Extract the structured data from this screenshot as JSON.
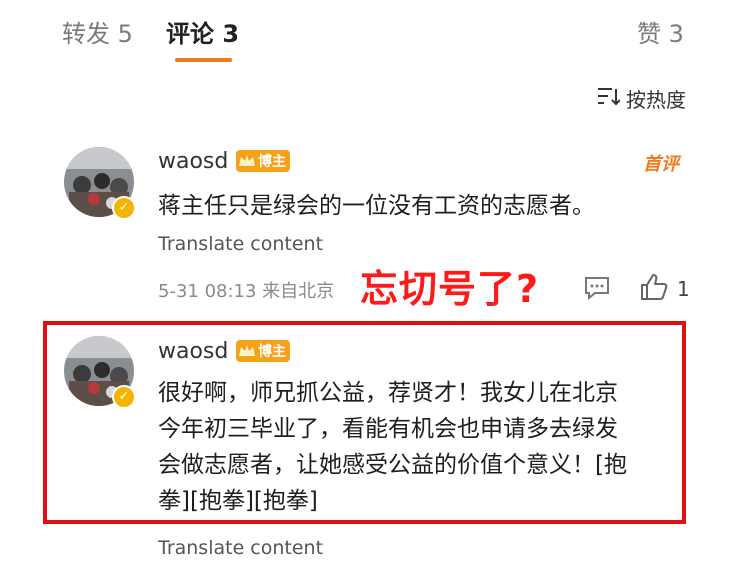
{
  "tabs": {
    "repost": "转发 5",
    "comments": "评论 3",
    "likes": "赞 3"
  },
  "sort": {
    "label": "按热度"
  },
  "comments": [
    {
      "username": "waosd",
      "badge": "博主",
      "author_tag": "首评",
      "text": "蒋主任只是绿会的一位没有工资的志愿者。",
      "translate": "Translate content",
      "meta": "5-31 08:13 来自北京",
      "like_count": "1"
    },
    {
      "username": "waosd",
      "badge": "博主",
      "text_lines": [
        "很好啊，师兄抓公益，荐贤才！我女儿在北京",
        "今年初三毕业了，看能有机会也申请多去绿发",
        "会做志愿者，让她感受公益的价值个意义！[抱",
        "拳][抱拳][抱拳]"
      ],
      "translate": "Translate content"
    }
  ],
  "overlay": {
    "text": "忘切号了?"
  },
  "colors": {
    "accent": "#f07a1c",
    "highlight": "#e01010",
    "overlay": "#ff1a1a",
    "badge": "#f5a21a"
  }
}
